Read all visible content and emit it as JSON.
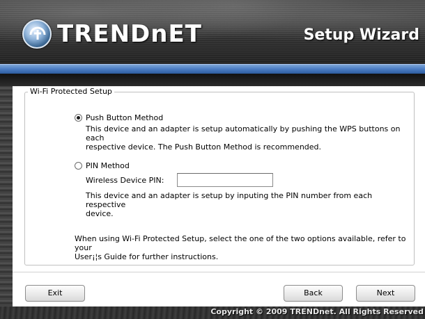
{
  "header": {
    "logo_text": "TRENDnET",
    "title": "Setup Wizard"
  },
  "wps": {
    "legend": "Wi-Fi Protected Setup",
    "push_button": {
      "label": "Push Button Method",
      "selected": true,
      "desc_line1": "This device and an adapter is setup automatically by pushing the WPS buttons on each",
      "desc_line2": "respective device. The Push Button Method is recommended."
    },
    "pin": {
      "label": "PIN Method",
      "selected": false,
      "field_label": "Wireless Device PIN:",
      "field_value": "",
      "desc_line1": "This device and an adapter is setup by inputing the PIN number from each respective",
      "desc_line2": "device."
    },
    "note_line1": "When using Wi-Fi Protected Setup, select the one of the two options available, refer to your",
    "note_line2": "User¡¦s Guide for further instructions."
  },
  "buttons": {
    "exit": "Exit",
    "back": "Back",
    "next": "Next"
  },
  "footer": {
    "copyright": "Copyright © 2009 TRENDnet. All Rights Reserved"
  },
  "colors": {
    "accent_bar": "#4f80c6",
    "frame": "#3a3a3a"
  }
}
